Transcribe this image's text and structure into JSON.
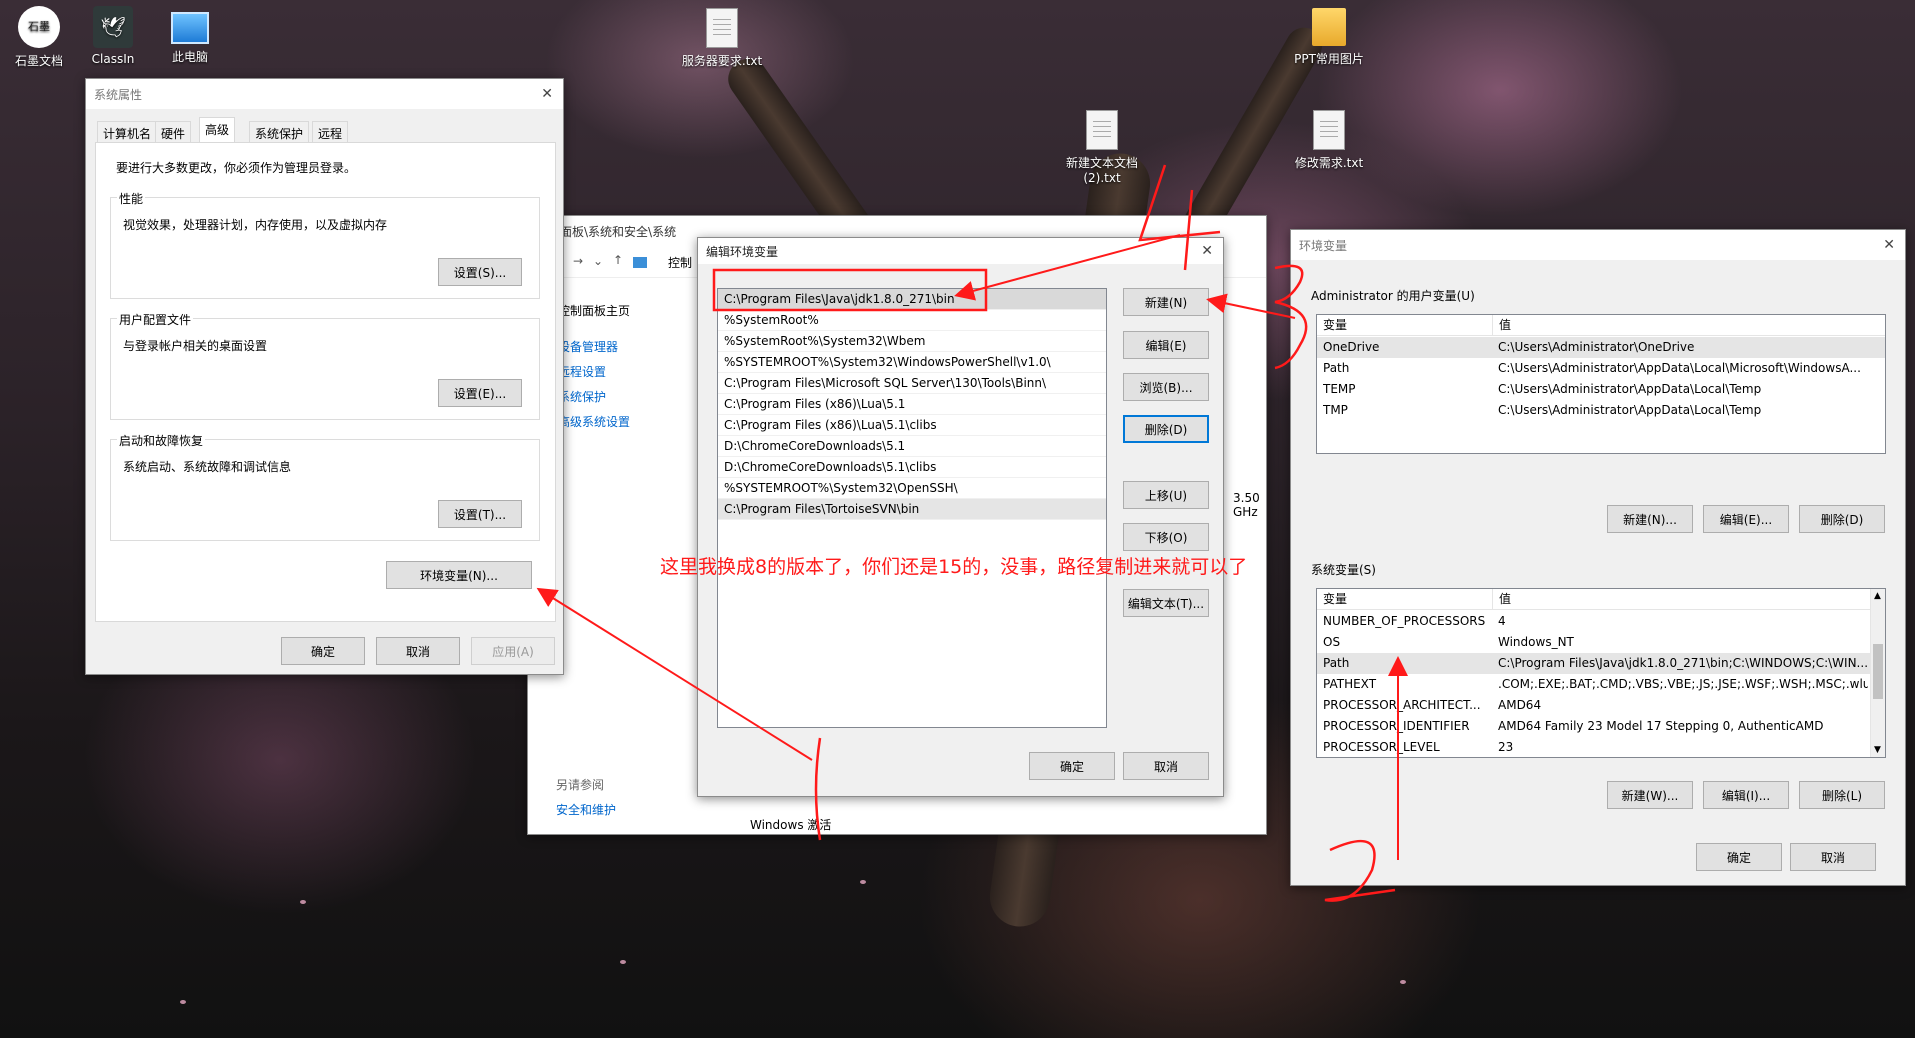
{
  "desktop": {
    "icons": [
      {
        "label": "石墨文档",
        "logo": "石墨"
      },
      {
        "label": "ClassIn"
      },
      {
        "label": "此电脑"
      },
      {
        "label": "服务器要求.txt"
      },
      {
        "label": "PPT常用图片"
      },
      {
        "label": "新建文本文档 (2).txt"
      },
      {
        "label": "修改需求.txt"
      }
    ]
  },
  "sys_props": {
    "title": "系统属性",
    "tabs": [
      "计算机名",
      "硬件",
      "高级",
      "系统保护",
      "远程"
    ],
    "admin_note": "要进行大多数更改，你必须作为管理员登录。",
    "perf": {
      "label": "性能",
      "desc": "视觉效果，处理器计划，内存使用，以及虚拟内存",
      "btn": "设置(S)..."
    },
    "profile": {
      "label": "用户配置文件",
      "desc": "与登录帐户相关的桌面设置",
      "btn": "设置(E)..."
    },
    "startup": {
      "label": "启动和故障恢复",
      "desc": "系统启动、系统故障和调试信息",
      "btn": "设置(T)..."
    },
    "env_btn": "环境变量(N)...",
    "ok": "确定",
    "cancel": "取消",
    "apply": "应用(A)"
  },
  "control_panel": {
    "path": "控制面板\\系统和安全\\系统",
    "crumb": "控制",
    "home": "控制面板主页",
    "links": [
      "设备管理器",
      "远程设置",
      "系统保护",
      "高级系统设置"
    ],
    "cpu_speed": "3.50 GHz",
    "see_also": "另请参阅",
    "security": "安全和维护",
    "activation": "Windows 激活"
  },
  "edit_env": {
    "title": "编辑环境变量",
    "paths": [
      "C:\\Program Files\\Java\\jdk1.8.0_271\\bin",
      "%SystemRoot%",
      "%SystemRoot%\\System32\\Wbem",
      "%SYSTEMROOT%\\System32\\WindowsPowerShell\\v1.0\\",
      "C:\\Program Files\\Microsoft SQL Server\\130\\Tools\\Binn\\",
      "C:\\Program Files (x86)\\Lua\\5.1",
      "C:\\Program Files (x86)\\Lua\\5.1\\clibs",
      "D:\\ChromeCoreDownloads\\5.1",
      "D:\\ChromeCoreDownloads\\5.1\\clibs",
      "%SYSTEMROOT%\\System32\\OpenSSH\\",
      "C:\\Program Files\\TortoiseSVN\\bin"
    ],
    "buttons": {
      "new": "新建(N)",
      "edit": "编辑(E)",
      "browse": "浏览(B)...",
      "delete": "删除(D)",
      "up": "上移(U)",
      "down": "下移(O)",
      "edit_text": "编辑文本(T)..."
    },
    "ok": "确定",
    "cancel": "取消"
  },
  "env_vars": {
    "title": "环境变量",
    "user_label": "Administrator 的用户变量(U)",
    "col_var": "变量",
    "col_val": "值",
    "user_vars": [
      {
        "name": "OneDrive",
        "value": "C:\\Users\\Administrator\\OneDrive"
      },
      {
        "name": "Path",
        "value": "C:\\Users\\Administrator\\AppData\\Local\\Microsoft\\WindowsA..."
      },
      {
        "name": "TEMP",
        "value": "C:\\Users\\Administrator\\AppData\\Local\\Temp"
      },
      {
        "name": "TMP",
        "value": "C:\\Users\\Administrator\\AppData\\Local\\Temp"
      }
    ],
    "user_buttons": {
      "new": "新建(N)...",
      "edit": "编辑(E)...",
      "delete": "删除(D)"
    },
    "sys_label": "系统变量(S)",
    "sys_vars": [
      {
        "name": "NUMBER_OF_PROCESSORS",
        "value": "4"
      },
      {
        "name": "OS",
        "value": "Windows_NT"
      },
      {
        "name": "Path",
        "value": "C:\\Program Files\\Java\\jdk1.8.0_271\\bin;C:\\WINDOWS;C:\\WIN..."
      },
      {
        "name": "PATHEXT",
        "value": ".COM;.EXE;.BAT;.CMD;.VBS;.VBE;.JS;.JSE;.WSF;.WSH;.MSC;.wlua..."
      },
      {
        "name": "PROCESSOR_ARCHITECT...",
        "value": "AMD64"
      },
      {
        "name": "PROCESSOR_IDENTIFIER",
        "value": "AMD64 Family 23 Model 17 Stepping 0, AuthenticAMD"
      },
      {
        "name": "PROCESSOR_LEVEL",
        "value": "23"
      }
    ],
    "sys_buttons": {
      "new": "新建(W)...",
      "edit": "编辑(I)...",
      "delete": "删除(L)"
    },
    "ok": "确定",
    "cancel": "取消"
  },
  "annotations": {
    "note": "这里我换成8的版本了，你们还是15的，没事，路径复制进来就可以了",
    "color": "#ff1a1a"
  }
}
